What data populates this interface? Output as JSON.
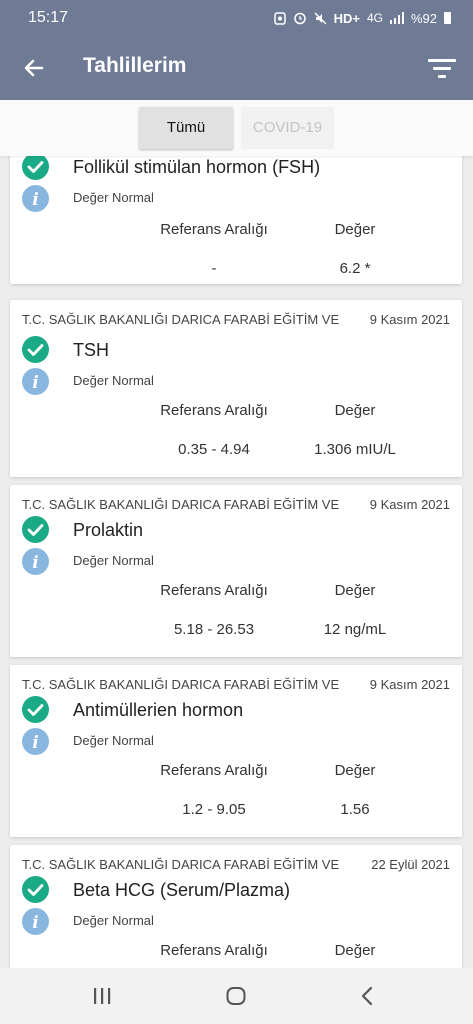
{
  "status_bar": {
    "time": "15:17",
    "network": "HD+",
    "network_sub": "4G",
    "battery": "%92",
    "icons": [
      "notification-icon",
      "alarm-icon",
      "mute-icon",
      "signal-icon",
      "battery-icon"
    ]
  },
  "header": {
    "title": "Tahlillerim",
    "back_icon": "arrow-left-icon",
    "filter_icon": "filter-icon",
    "background": "#6f7a95"
  },
  "tabs": [
    {
      "label": "Tümü",
      "selected": true
    },
    {
      "label": "COVID-19",
      "selected": false
    }
  ],
  "columns": {
    "reference": "Referans Aralığı",
    "value": "Değer"
  },
  "colors": {
    "check": "#1aaa85",
    "info": "#89b6de"
  },
  "results": [
    {
      "hospital": "",
      "date": "",
      "name": "Follikül stimülan hormon (FSH)",
      "status": "Değer Normal",
      "reference": "-",
      "value": "6.2 *"
    },
    {
      "hospital": "T.C. SAĞLIK BAKANLIĞI DARICA FARABİ EĞİTİM VE",
      "date": "9 Kasım 2021",
      "name": "TSH",
      "status": "Değer Normal",
      "reference": "0.35 - 4.94",
      "value": "1.306 mIU/L"
    },
    {
      "hospital": "T.C. SAĞLIK BAKANLIĞI DARICA FARABİ EĞİTİM VE",
      "date": "9 Kasım 2021",
      "name": "Prolaktin",
      "status": "Değer Normal",
      "reference": "5.18 - 26.53",
      "value": "12 ng/mL"
    },
    {
      "hospital": "T.C. SAĞLIK BAKANLIĞI DARICA FARABİ EĞİTİM VE",
      "date": "9 Kasım 2021",
      "name": "Antimüllerien hormon",
      "status": "Değer Normal",
      "reference": "1.2 - 9.05",
      "value": "1.56"
    },
    {
      "hospital": "T.C. SAĞLIK BAKANLIĞI DARICA FARABİ EĞİTİM VE",
      "date": "22 Eylül 2021",
      "name": "Beta HCG (Serum/Plazma)",
      "status": "Değer Normal",
      "reference": "",
      "value": ""
    }
  ],
  "nav": {
    "recents": "recents-icon",
    "home": "home-icon",
    "back": "back-icon"
  }
}
